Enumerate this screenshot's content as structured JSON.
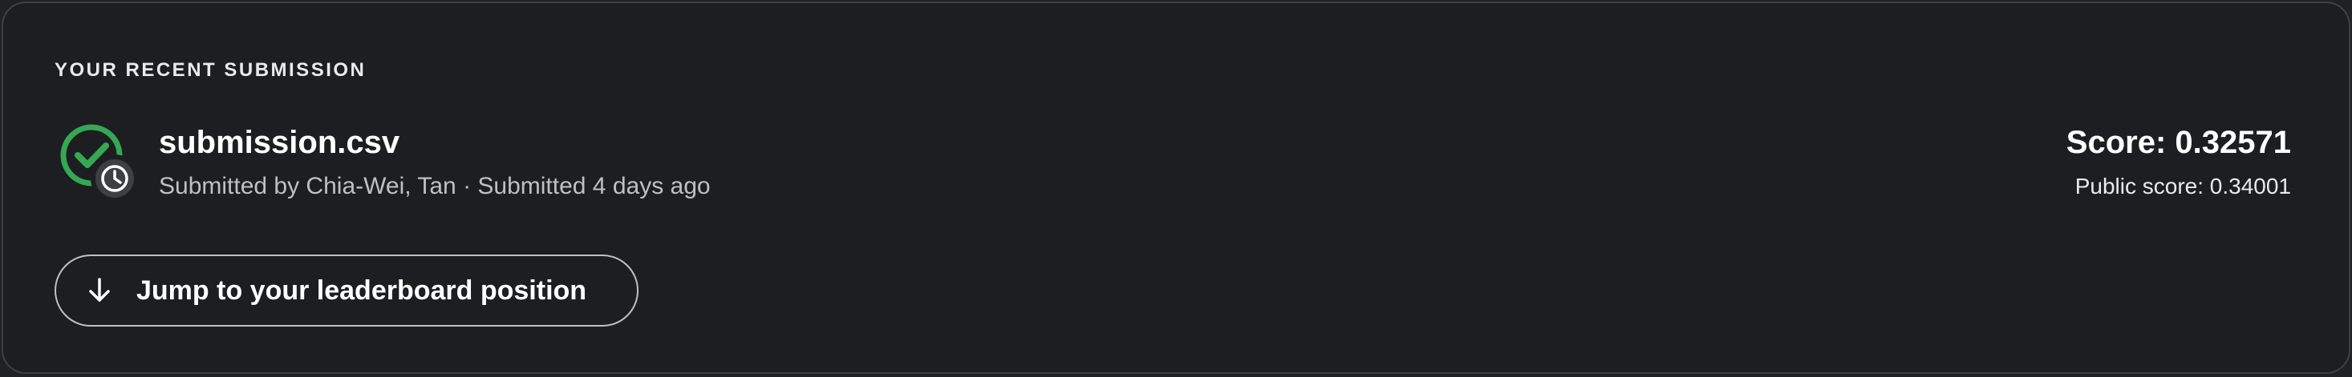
{
  "submission_card": {
    "heading": "YOUR RECENT SUBMISSION",
    "file_name": "submission.csv",
    "meta": "Submitted by Chia-Wei, Tan · Submitted 4 days ago",
    "score": "Score: 0.32571",
    "public_score": "Public score: 0.34001",
    "jump_button_label": "Jump to your leaderboard position",
    "status_icon": "check-circle-icon",
    "pending_icon": "clock-icon",
    "jump_icon": "arrow-down-icon"
  },
  "colors": {
    "background": "#1d1e21",
    "border": "#3c4043",
    "success_green": "#34a853",
    "text_primary": "#ffffff",
    "text_secondary": "#bdc1c6"
  }
}
